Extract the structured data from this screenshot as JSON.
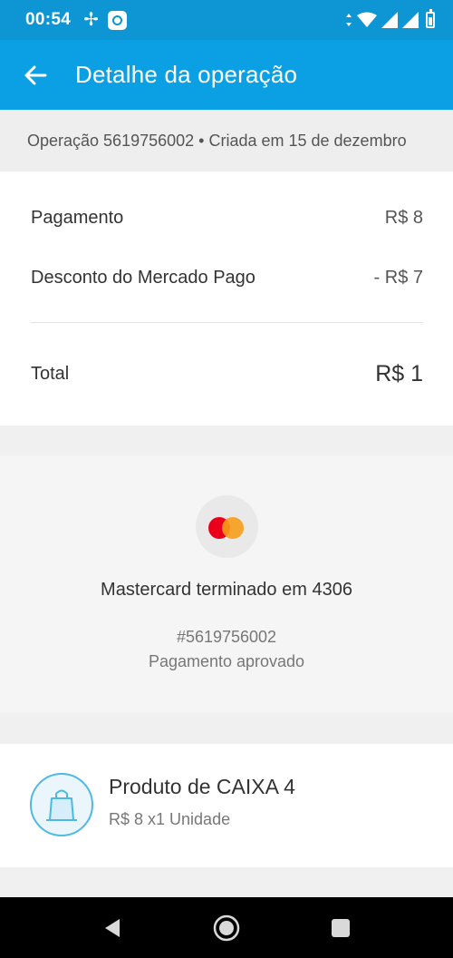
{
  "status_bar": {
    "time": "00:54"
  },
  "app_bar": {
    "title": "Detalhe da operação"
  },
  "operation": {
    "info": "Operação 5619756002 • Criada em 15 de dezembro"
  },
  "summary": {
    "payment_label": "Pagamento",
    "payment_value": "R$ 8",
    "discount_label": "Desconto do Mercado Pago",
    "discount_value": "- R$ 7",
    "total_label": "Total",
    "total_value": "R$ 1"
  },
  "payment_method": {
    "card_text": "Mastercard terminado em 4306",
    "operation_number": "#5619756002",
    "status": "Pagamento aprovado",
    "brand_colors": {
      "left": "#eb001b",
      "right": "#f79e1b"
    }
  },
  "product": {
    "name": "Produto de CAIXA 4",
    "detail": "R$ 8 x1 Unidade"
  },
  "colors": {
    "status_bar": "#0e95d3",
    "app_bar": "#0ba0e3",
    "accent": "#4fb9e6"
  }
}
